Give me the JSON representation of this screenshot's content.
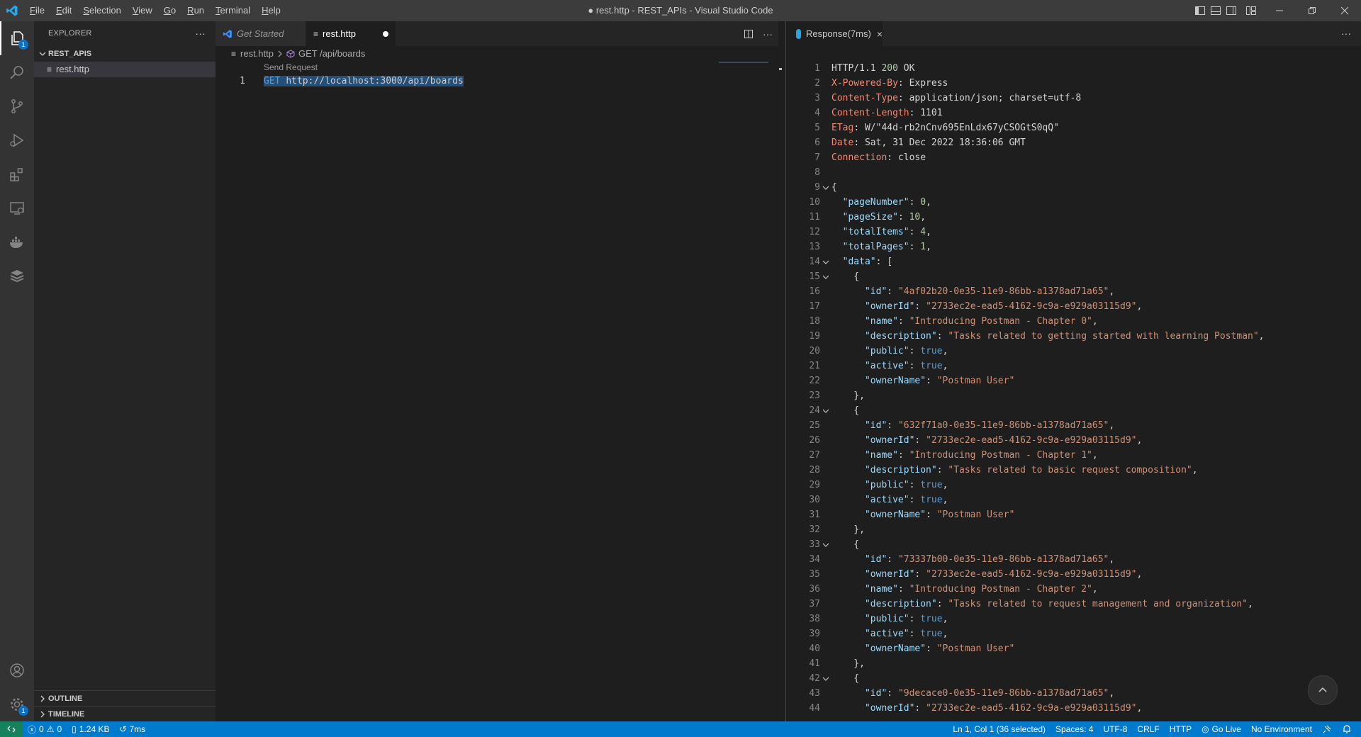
{
  "titlebar": {
    "menus": [
      "File",
      "Edit",
      "Selection",
      "View",
      "Go",
      "Run",
      "Terminal",
      "Help"
    ],
    "window_title": "● rest.http - REST_APIs - Visual Studio Code"
  },
  "activity": {
    "explorer_badge": "1",
    "settings_badge": "1"
  },
  "sidebar": {
    "title": "EXPLORER",
    "more": "···",
    "folder": "REST_APIS",
    "files": [
      "rest.http"
    ],
    "outline": "OUTLINE",
    "timeline": "TIMELINE"
  },
  "editor_left": {
    "tabs": [
      {
        "label": "Get Started"
      },
      {
        "label": "rest.http"
      }
    ],
    "breadcrumb": {
      "file": "rest.http",
      "symbol": "GET /api/boards"
    },
    "codelens": "Send Request",
    "line_number": "1",
    "method": "GET",
    "url": "http://localhost:3000/api/boards"
  },
  "editor_right": {
    "tab_label": "Response(7ms)",
    "lines": [
      {
        "n": "1",
        "t": [
          [
            "txt",
            "HTTP/1.1 "
          ],
          [
            "num",
            "200"
          ],
          [
            "txt",
            " OK"
          ]
        ]
      },
      {
        "n": "2",
        "t": [
          [
            "hk",
            "X-Powered-By"
          ],
          [
            "txt",
            ": Express"
          ]
        ]
      },
      {
        "n": "3",
        "t": [
          [
            "hk",
            "Content-Type"
          ],
          [
            "txt",
            ": application/json; charset=utf-8"
          ]
        ]
      },
      {
        "n": "4",
        "t": [
          [
            "hk",
            "Content-Length"
          ],
          [
            "txt",
            ": 1101"
          ]
        ]
      },
      {
        "n": "5",
        "t": [
          [
            "hk",
            "ETag"
          ],
          [
            "txt",
            ": W/\"44d-rb2nCnv695EnLdx67yCSOGtS0qQ\""
          ]
        ]
      },
      {
        "n": "6",
        "t": [
          [
            "hk",
            "Date"
          ],
          [
            "txt",
            ": Sat, 31 Dec 2022 18:36:06 GMT"
          ]
        ]
      },
      {
        "n": "7",
        "t": [
          [
            "hk",
            "Connection"
          ],
          [
            "txt",
            ": close"
          ]
        ]
      },
      {
        "n": "8",
        "t": []
      },
      {
        "n": "9",
        "f": true,
        "t": [
          [
            "txt",
            "{"
          ]
        ]
      },
      {
        "n": "10",
        "t": [
          [
            "txt",
            "  "
          ],
          [
            "jk",
            "\"pageNumber\""
          ],
          [
            "txt",
            ": "
          ],
          [
            "num",
            "0"
          ],
          [
            "txt",
            ","
          ]
        ]
      },
      {
        "n": "11",
        "t": [
          [
            "txt",
            "  "
          ],
          [
            "jk",
            "\"pageSize\""
          ],
          [
            "txt",
            ": "
          ],
          [
            "num",
            "10"
          ],
          [
            "txt",
            ","
          ]
        ]
      },
      {
        "n": "12",
        "t": [
          [
            "txt",
            "  "
          ],
          [
            "jk",
            "\"totalItems\""
          ],
          [
            "txt",
            ": "
          ],
          [
            "num",
            "4"
          ],
          [
            "txt",
            ","
          ]
        ]
      },
      {
        "n": "13",
        "t": [
          [
            "txt",
            "  "
          ],
          [
            "jk",
            "\"totalPages\""
          ],
          [
            "txt",
            ": "
          ],
          [
            "num",
            "1"
          ],
          [
            "txt",
            ","
          ]
        ]
      },
      {
        "n": "14",
        "f": true,
        "t": [
          [
            "txt",
            "  "
          ],
          [
            "jk",
            "\"data\""
          ],
          [
            "txt",
            ": ["
          ]
        ]
      },
      {
        "n": "15",
        "f": true,
        "t": [
          [
            "txt",
            "    {"
          ]
        ]
      },
      {
        "n": "16",
        "t": [
          [
            "txt",
            "      "
          ],
          [
            "jk",
            "\"id\""
          ],
          [
            "txt",
            ": "
          ],
          [
            "js",
            "\"4af02b20-0e35-11e9-86bb-a1378ad71a65\""
          ],
          [
            "txt",
            ","
          ]
        ]
      },
      {
        "n": "17",
        "t": [
          [
            "txt",
            "      "
          ],
          [
            "jk",
            "\"ownerId\""
          ],
          [
            "txt",
            ": "
          ],
          [
            "js",
            "\"2733ec2e-ead5-4162-9c9a-e929a03115d9\""
          ],
          [
            "txt",
            ","
          ]
        ]
      },
      {
        "n": "18",
        "t": [
          [
            "txt",
            "      "
          ],
          [
            "jk",
            "\"name\""
          ],
          [
            "txt",
            ": "
          ],
          [
            "js",
            "\"Introducing Postman - Chapter 0\""
          ],
          [
            "txt",
            ","
          ]
        ]
      },
      {
        "n": "19",
        "t": [
          [
            "txt",
            "      "
          ],
          [
            "jk",
            "\"description\""
          ],
          [
            "txt",
            ": "
          ],
          [
            "js",
            "\"Tasks related to getting started with learning Postman\""
          ],
          [
            "txt",
            ","
          ]
        ]
      },
      {
        "n": "20",
        "t": [
          [
            "txt",
            "      "
          ],
          [
            "jk",
            "\"public\""
          ],
          [
            "txt",
            ": "
          ],
          [
            "jb",
            "true"
          ],
          [
            "txt",
            ","
          ]
        ]
      },
      {
        "n": "21",
        "t": [
          [
            "txt",
            "      "
          ],
          [
            "jk",
            "\"active\""
          ],
          [
            "txt",
            ": "
          ],
          [
            "jb",
            "true"
          ],
          [
            "txt",
            ","
          ]
        ]
      },
      {
        "n": "22",
        "t": [
          [
            "txt",
            "      "
          ],
          [
            "jk",
            "\"ownerName\""
          ],
          [
            "txt",
            ": "
          ],
          [
            "js",
            "\"Postman User\""
          ]
        ]
      },
      {
        "n": "23",
        "t": [
          [
            "txt",
            "    },"
          ]
        ]
      },
      {
        "n": "24",
        "f": true,
        "t": [
          [
            "txt",
            "    {"
          ]
        ]
      },
      {
        "n": "25",
        "t": [
          [
            "txt",
            "      "
          ],
          [
            "jk",
            "\"id\""
          ],
          [
            "txt",
            ": "
          ],
          [
            "js",
            "\"632f71a0-0e35-11e9-86bb-a1378ad71a65\""
          ],
          [
            "txt",
            ","
          ]
        ]
      },
      {
        "n": "26",
        "t": [
          [
            "txt",
            "      "
          ],
          [
            "jk",
            "\"ownerId\""
          ],
          [
            "txt",
            ": "
          ],
          [
            "js",
            "\"2733ec2e-ead5-4162-9c9a-e929a03115d9\""
          ],
          [
            "txt",
            ","
          ]
        ]
      },
      {
        "n": "27",
        "t": [
          [
            "txt",
            "      "
          ],
          [
            "jk",
            "\"name\""
          ],
          [
            "txt",
            ": "
          ],
          [
            "js",
            "\"Introducing Postman - Chapter 1\""
          ],
          [
            "txt",
            ","
          ]
        ]
      },
      {
        "n": "28",
        "t": [
          [
            "txt",
            "      "
          ],
          [
            "jk",
            "\"description\""
          ],
          [
            "txt",
            ": "
          ],
          [
            "js",
            "\"Tasks related to basic request composition\""
          ],
          [
            "txt",
            ","
          ]
        ]
      },
      {
        "n": "29",
        "t": [
          [
            "txt",
            "      "
          ],
          [
            "jk",
            "\"public\""
          ],
          [
            "txt",
            ": "
          ],
          [
            "jb",
            "true"
          ],
          [
            "txt",
            ","
          ]
        ]
      },
      {
        "n": "30",
        "t": [
          [
            "txt",
            "      "
          ],
          [
            "jk",
            "\"active\""
          ],
          [
            "txt",
            ": "
          ],
          [
            "jb",
            "true"
          ],
          [
            "txt",
            ","
          ]
        ]
      },
      {
        "n": "31",
        "t": [
          [
            "txt",
            "      "
          ],
          [
            "jk",
            "\"ownerName\""
          ],
          [
            "txt",
            ": "
          ],
          [
            "js",
            "\"Postman User\""
          ]
        ]
      },
      {
        "n": "32",
        "t": [
          [
            "txt",
            "    },"
          ]
        ]
      },
      {
        "n": "33",
        "f": true,
        "t": [
          [
            "txt",
            "    {"
          ]
        ]
      },
      {
        "n": "34",
        "t": [
          [
            "txt",
            "      "
          ],
          [
            "jk",
            "\"id\""
          ],
          [
            "txt",
            ": "
          ],
          [
            "js",
            "\"73337b00-0e35-11e9-86bb-a1378ad71a65\""
          ],
          [
            "txt",
            ","
          ]
        ]
      },
      {
        "n": "35",
        "t": [
          [
            "txt",
            "      "
          ],
          [
            "jk",
            "\"ownerId\""
          ],
          [
            "txt",
            ": "
          ],
          [
            "js",
            "\"2733ec2e-ead5-4162-9c9a-e929a03115d9\""
          ],
          [
            "txt",
            ","
          ]
        ]
      },
      {
        "n": "36",
        "t": [
          [
            "txt",
            "      "
          ],
          [
            "jk",
            "\"name\""
          ],
          [
            "txt",
            ": "
          ],
          [
            "js",
            "\"Introducing Postman - Chapter 2\""
          ],
          [
            "txt",
            ","
          ]
        ]
      },
      {
        "n": "37",
        "t": [
          [
            "txt",
            "      "
          ],
          [
            "jk",
            "\"description\""
          ],
          [
            "txt",
            ": "
          ],
          [
            "js",
            "\"Tasks related to request management and organization\""
          ],
          [
            "txt",
            ","
          ]
        ]
      },
      {
        "n": "38",
        "t": [
          [
            "txt",
            "      "
          ],
          [
            "jk",
            "\"public\""
          ],
          [
            "txt",
            ": "
          ],
          [
            "jb",
            "true"
          ],
          [
            "txt",
            ","
          ]
        ]
      },
      {
        "n": "39",
        "t": [
          [
            "txt",
            "      "
          ],
          [
            "jk",
            "\"active\""
          ],
          [
            "txt",
            ": "
          ],
          [
            "jb",
            "true"
          ],
          [
            "txt",
            ","
          ]
        ]
      },
      {
        "n": "40",
        "t": [
          [
            "txt",
            "      "
          ],
          [
            "jk",
            "\"ownerName\""
          ],
          [
            "txt",
            ": "
          ],
          [
            "js",
            "\"Postman User\""
          ]
        ]
      },
      {
        "n": "41",
        "t": [
          [
            "txt",
            "    },"
          ]
        ]
      },
      {
        "n": "42",
        "f": true,
        "t": [
          [
            "txt",
            "    {"
          ]
        ]
      },
      {
        "n": "43",
        "t": [
          [
            "txt",
            "      "
          ],
          [
            "jk",
            "\"id\""
          ],
          [
            "txt",
            ": "
          ],
          [
            "js",
            "\"9decace0-0e35-11e9-86bb-a1378ad71a65\""
          ],
          [
            "txt",
            ","
          ]
        ]
      },
      {
        "n": "44",
        "t": [
          [
            "txt",
            "      "
          ],
          [
            "jk",
            "\"ownerId\""
          ],
          [
            "txt",
            ": "
          ],
          [
            "js",
            "\"2733ec2e-ead5-4162-9c9a-e929a03115d9\""
          ],
          [
            "txt",
            ","
          ]
        ]
      }
    ]
  },
  "statusbar": {
    "errors": "0",
    "warnings": "0",
    "size": "1.24 KB",
    "time": "7ms",
    "position": "Ln 1, Col 1 (36 selected)",
    "spaces": "Spaces: 4",
    "encoding": "UTF-8",
    "eol": "CRLF",
    "language": "HTTP",
    "golive": "Go Live",
    "environment": "No Environment"
  }
}
